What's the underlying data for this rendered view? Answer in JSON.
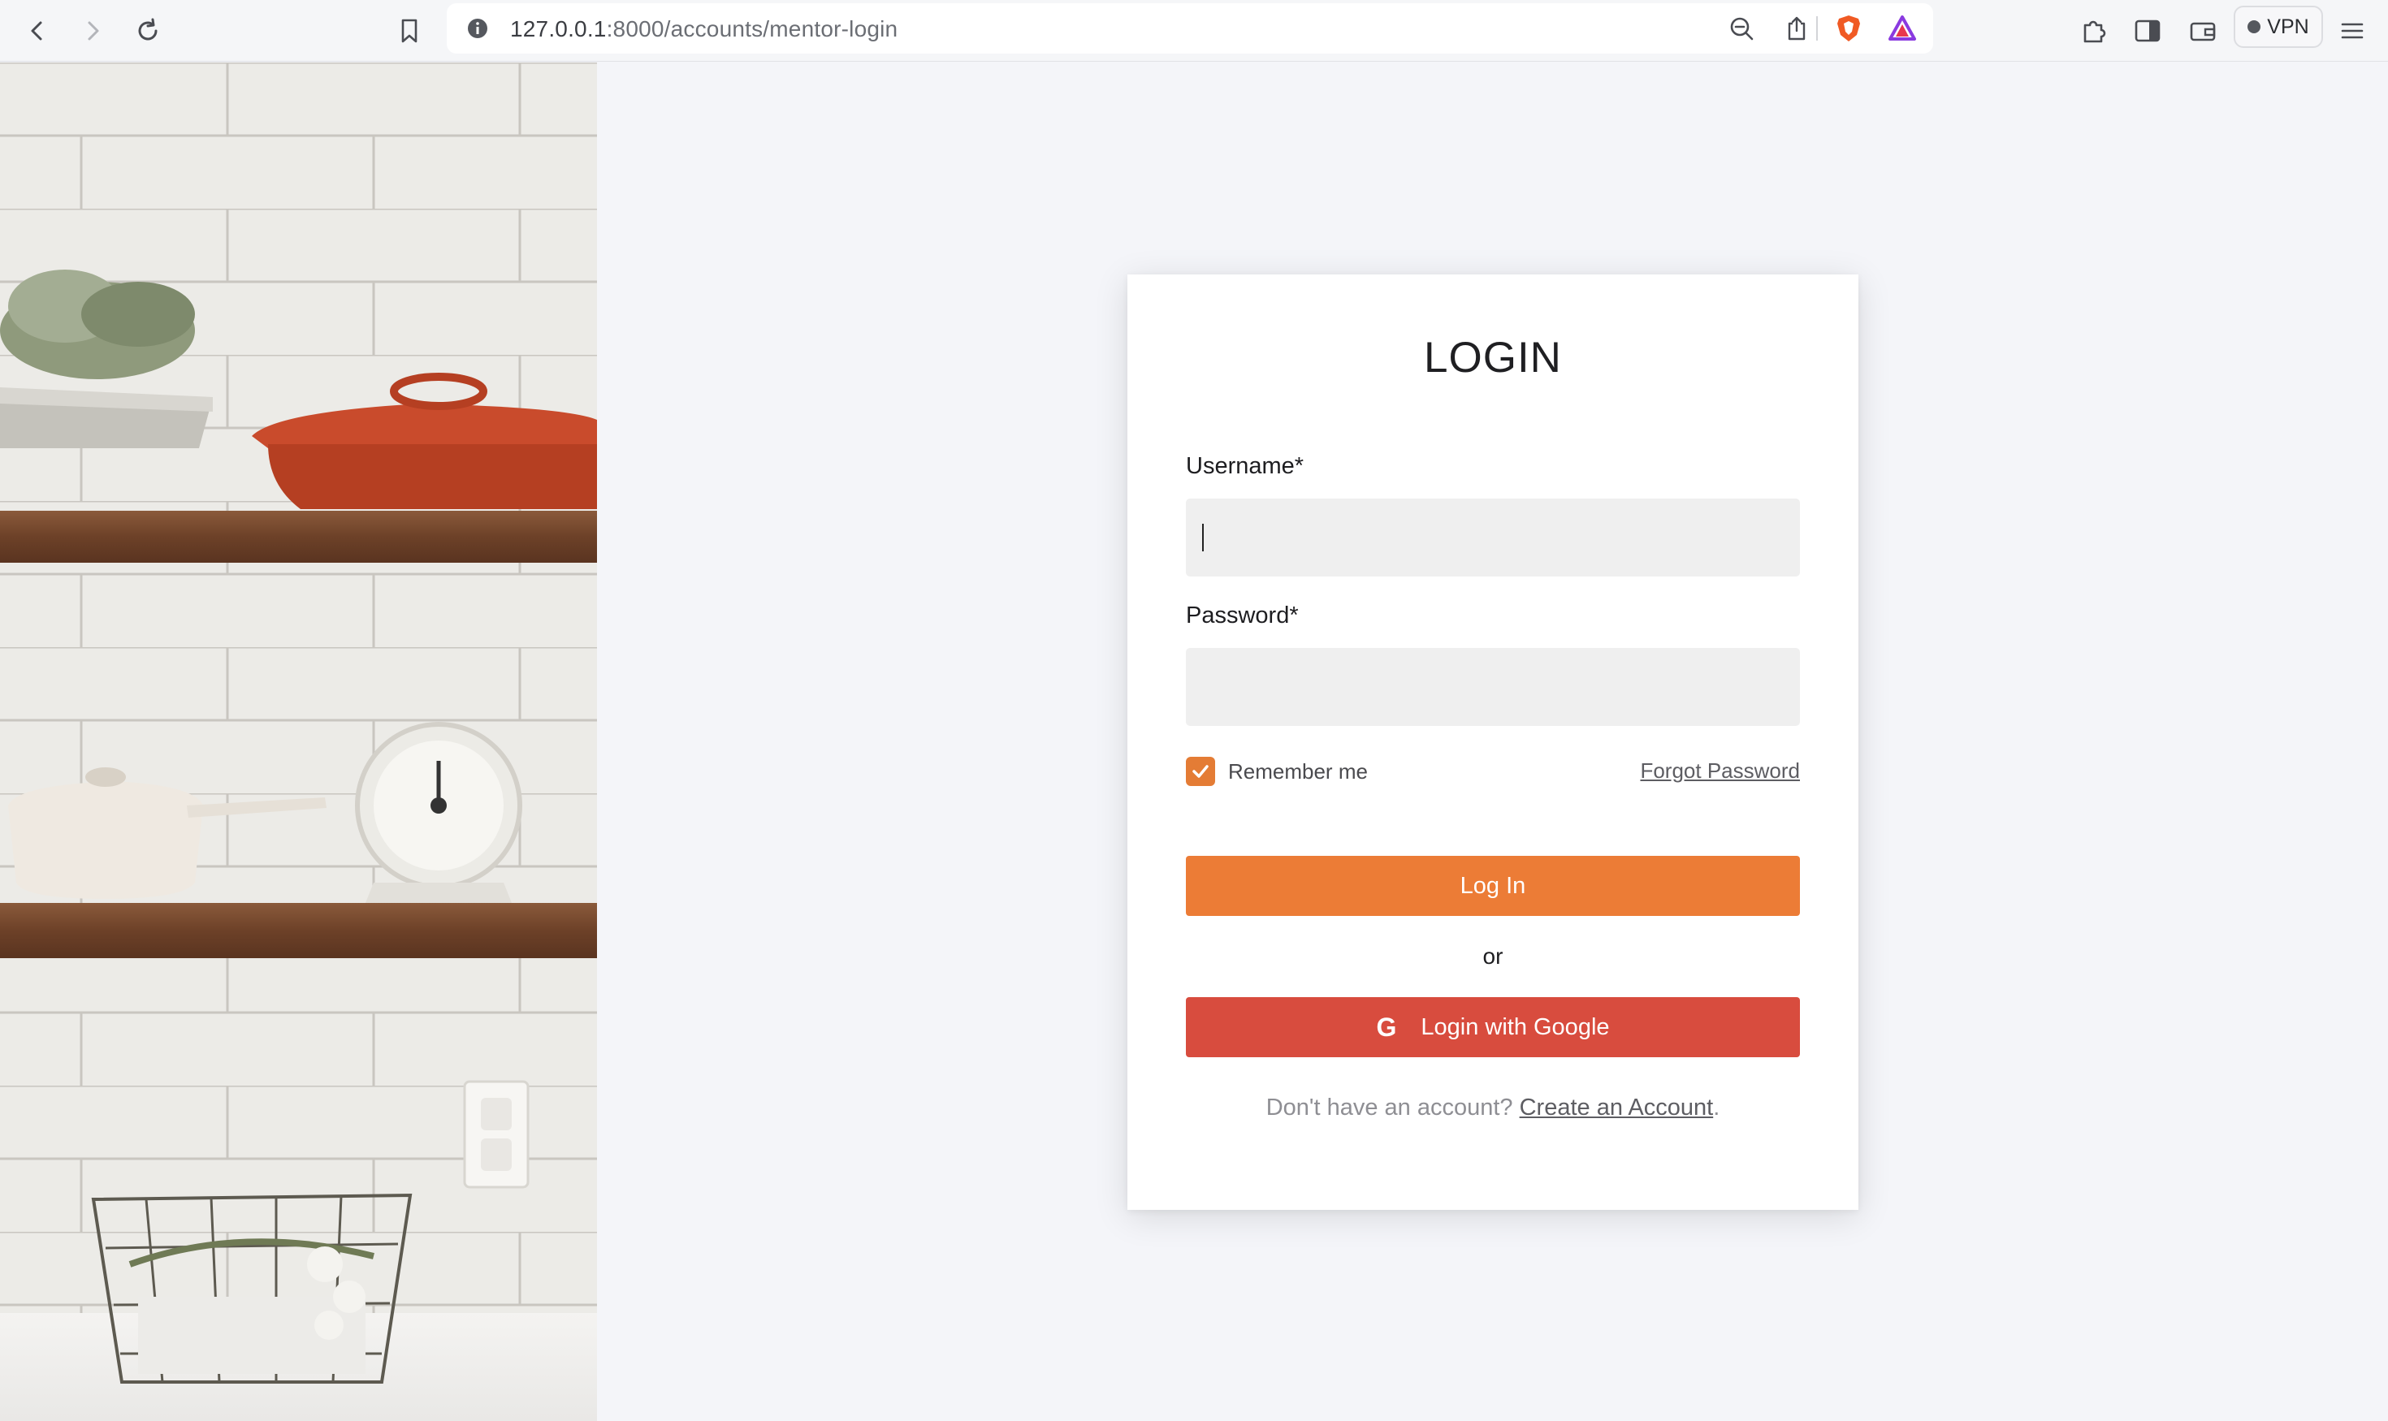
{
  "browser": {
    "url_host": "127.0.0.1",
    "url_rest": ":8000/accounts/mentor-login",
    "vpn_label": "VPN"
  },
  "login": {
    "title": "LOGIN",
    "username_label": "Username*",
    "username_value": "",
    "password_label": "Password*",
    "password_value": "",
    "remember_label": "Remember me",
    "remember_checked": true,
    "forgot_label": "Forgot Password",
    "login_button": "Log In",
    "or_text": "or",
    "google_icon": "G",
    "google_button": "Login with Google",
    "signup_prompt": "Don't have an account?",
    "signup_link": "Create an Account",
    "signup_end": "."
  },
  "colors": {
    "accent_orange": "#ec7c36",
    "google_red": "#d84c3e"
  }
}
